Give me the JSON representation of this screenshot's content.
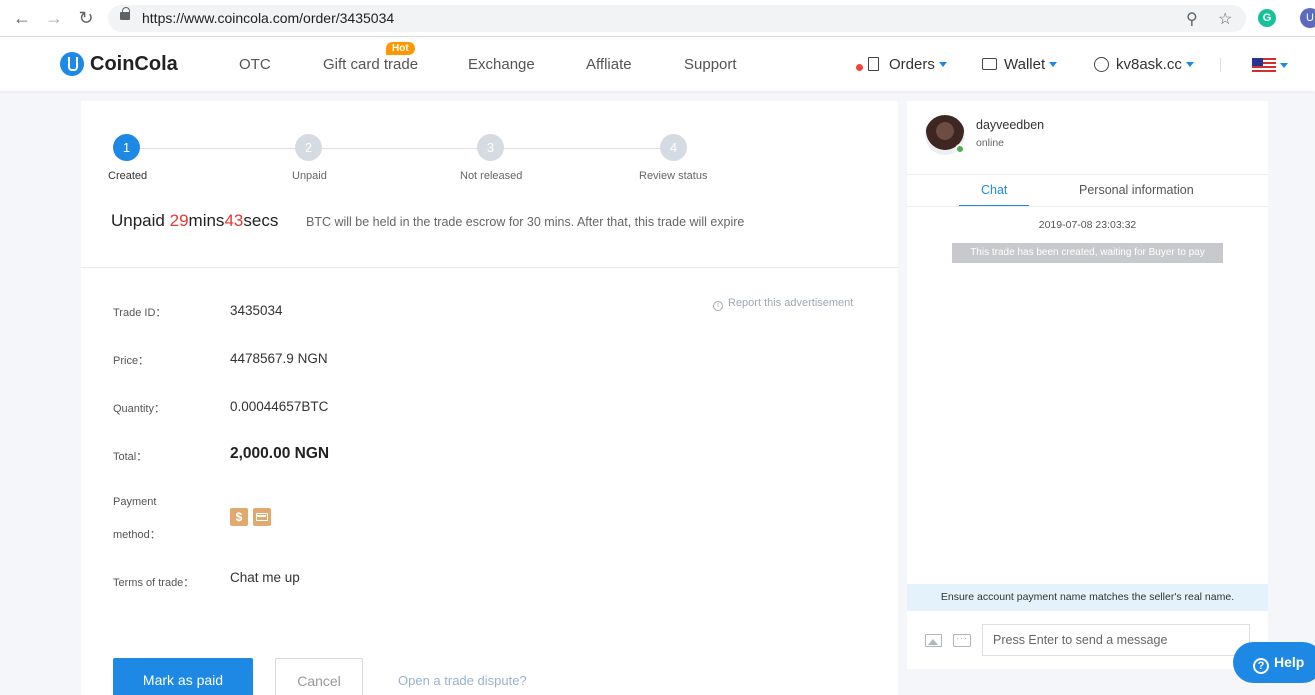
{
  "browser": {
    "url": "https://www.coincola.com/order/3435034",
    "profile_initial": "U",
    "extension_initial": "G"
  },
  "header": {
    "brand": "CoinCola",
    "nav": [
      "OTC",
      "Gift card trade",
      "Exchange",
      "Affliate",
      "Support"
    ],
    "hot_badge": "Hot",
    "orders": "Orders",
    "wallet": "Wallet",
    "username": "kv8ask.cc"
  },
  "steps": [
    {
      "num": "1",
      "label": "Created"
    },
    {
      "num": "2",
      "label": "Unpaid"
    },
    {
      "num": "3",
      "label": "Not released"
    },
    {
      "num": "4",
      "label": "Review status"
    }
  ],
  "timer": {
    "prefix": "Unpaid ",
    "mins": "29",
    "mins_unit": "mins",
    "secs": "43",
    "secs_unit": "secs",
    "escrow_note": "BTC will be held in the trade escrow for 30 mins. After that, this trade will expire"
  },
  "details": {
    "report_link": "Report this advertisement",
    "trade_id_label": "Trade ID：",
    "trade_id": "3435034",
    "price_label": "Price：",
    "price": "4478567.9 NGN",
    "quantity_label": "Quantity：",
    "quantity": "0.00044657BTC",
    "total_label": "Total：",
    "total": "2,000.00 NGN",
    "payment_label_1": "Payment",
    "payment_label_2": "method：",
    "terms_label": "Terms of trade：",
    "terms": "Chat me up"
  },
  "actions": {
    "mark_paid": "Mark as paid",
    "cancel": "Cancel",
    "dispute": "Open a trade dispute?"
  },
  "chat": {
    "name": "dayveedben",
    "status": "online",
    "tabs": [
      "Chat",
      "Personal information"
    ],
    "timestamp": "2019-07-08 23:03:32",
    "system_message": "This trade has been created, waiting for Buyer to pay",
    "notice": "Ensure account payment name matches the seller's real name.",
    "input_placeholder": "Press Enter to send a message"
  },
  "help": "Help",
  "colors": {
    "accent": "#1e88e5",
    "timer_red": "#e53935",
    "hot": "#ff9800",
    "online": "#4caf50",
    "payment_icon": "#e0a96d"
  },
  "icons": [
    "back-icon",
    "forward-icon",
    "reload-icon",
    "lock-icon",
    "zoom-icon",
    "star-icon",
    "orders-doc-icon",
    "wallet-icon",
    "user-icon",
    "us-flag-icon",
    "dollar-icon",
    "card-icon",
    "info-icon",
    "image-icon",
    "emoji-icon",
    "help-icon"
  ]
}
